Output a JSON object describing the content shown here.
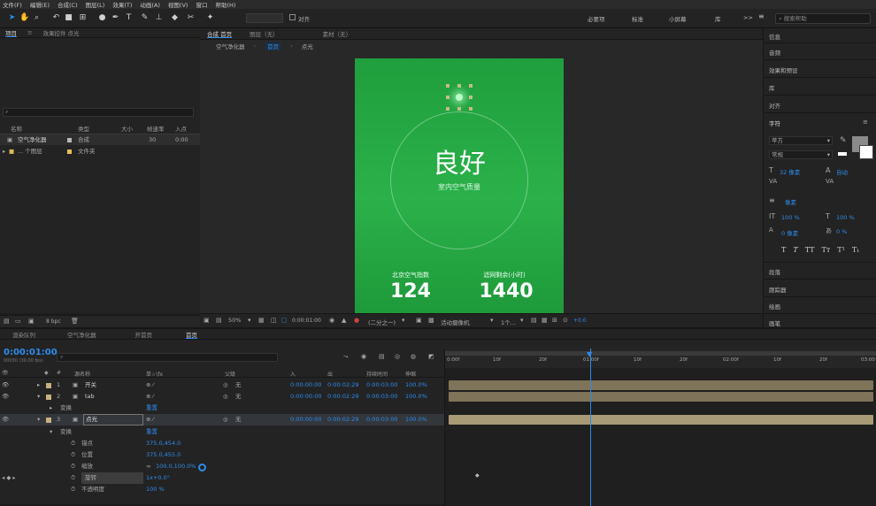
{
  "menu": [
    "文件(F)",
    "编辑(E)",
    "合成(C)",
    "图层(L)",
    "效果(T)",
    "动画(A)",
    "视图(V)",
    "窗口",
    "帮助(H)"
  ],
  "toolbar": {
    "snap_label": "对齐",
    "workspaces": [
      "必要项",
      "标准",
      "小屏幕",
      "库"
    ],
    "more": ">>",
    "search_placeholder": "搜索帮助"
  },
  "project": {
    "tabs": [
      "项目",
      "效果控件 点光"
    ],
    "columns": [
      "名称",
      "类型",
      "大小",
      "帧速率",
      "入点"
    ],
    "items": [
      {
        "name": "空气净化器",
        "type": "合成",
        "rate": "30",
        "in": "0:00",
        "color": "#b8b8b8"
      },
      {
        "name": "... 个图层",
        "type": "文件夹",
        "color": "#e2c35a"
      }
    ],
    "bpc": "8 bpc"
  },
  "viewer": {
    "tabs": [
      "合成 首页",
      "图层（无）",
      "素材（无）"
    ],
    "breadcrumb": [
      "空气净化器",
      "首页",
      "点光"
    ],
    "quality": "良好",
    "quality_sub": "室内空气质量",
    "stat1_label": "北京空气指数",
    "stat1_value": "124",
    "stat2_label": "滤网剩余(小时)",
    "stat2_value": "1440",
    "zoom": "50%",
    "timecode": "0:00:01:00",
    "resolution": "(二分之一)",
    "camera": "活动摄像机",
    "views": "1个...",
    "exposure": "+0.0"
  },
  "right_panel": {
    "sections": [
      "信息",
      "音频",
      "效果和预设",
      "库",
      "对齐",
      "字符"
    ],
    "font": "苹方",
    "style": "常规",
    "size": "32 像素",
    "auto": "自动",
    "unit": "像素",
    "scale1": "100 %",
    "scale2": "100 %",
    "baseline": "0 像素",
    "tsume": "0 %",
    "bottom_sections": [
      "段落",
      "跟踪器",
      "绘画",
      "画笔"
    ]
  },
  "timeline": {
    "tabs": [
      "渲染队列",
      "空气净化器",
      "开首页",
      "首页"
    ],
    "timecode": "0:00:01:00",
    "timecode_sub": "00030 (30.00 fps)",
    "columns": [
      "#",
      "源名称",
      "单☆\\fx",
      "父级",
      "入",
      "出",
      "持续时间",
      "伸缩"
    ],
    "ruler": [
      "0:00f",
      "10f",
      "20f",
      "01:00f",
      "10f",
      "20f",
      "02:00f",
      "10f",
      "20f",
      "03:00"
    ],
    "layers": [
      {
        "num": "1",
        "name": "开关",
        "parent": "无",
        "in": "0:00:00:00",
        "out": "0:00:02:29",
        "dur": "0:00:03:00",
        "stretch": "100.0%"
      },
      {
        "num": "2",
        "name": "tab",
        "parent": "无",
        "in": "0:00:00:00",
        "out": "0:00:02:29",
        "dur": "0:00:03:00",
        "stretch": "100.0%"
      },
      {
        "num": "3",
        "name": "点光",
        "parent": "无",
        "in": "0:00:00:00",
        "out": "0:00:02:29",
        "dur": "0:00:03:00",
        "stretch": "100.0%"
      }
    ],
    "transform_label": "变换",
    "reset_label": "重置",
    "props": [
      {
        "name": "锚点",
        "value": "375.0,454.0"
      },
      {
        "name": "位置",
        "value": "375.0,455.0"
      },
      {
        "name": "缩放",
        "value": "100.0,100.0%"
      },
      {
        "name": "旋转",
        "value": "1x+0.0°"
      },
      {
        "name": "不透明度",
        "value": "100 %"
      }
    ],
    "layer1_mode": "无"
  }
}
